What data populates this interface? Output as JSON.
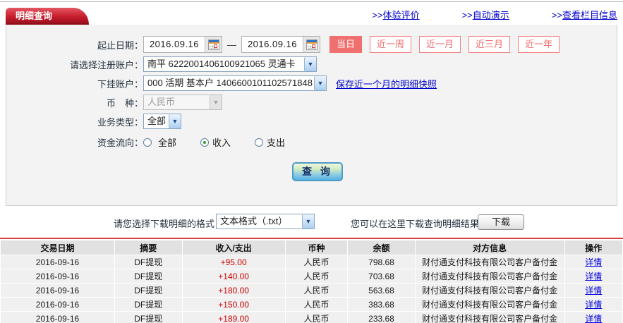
{
  "header": {
    "tab_title": "明细查询",
    "links": [
      {
        "prefix": ">>",
        "label": "体验评价"
      },
      {
        "prefix": ">>",
        "label": "自动演示"
      },
      {
        "prefix": ">>",
        "label": "查看栏目信息"
      }
    ]
  },
  "form": {
    "date_label": "起止日期：",
    "date_from": "2016.09.16",
    "date_separator": "—",
    "date_to": "2016.09.16",
    "quick_buttons": [
      {
        "label": "当日",
        "active": true
      },
      {
        "label": "近一周",
        "active": false
      },
      {
        "label": "近一月",
        "active": false
      },
      {
        "label": "近三月",
        "active": false
      },
      {
        "label": "近一年",
        "active": false
      }
    ],
    "register_account_label": "请选择注册账户：",
    "register_account_value": "南平 6222001406100921065 灵通卡",
    "sub_account_label": "下挂账户：",
    "sub_account_value": "000 活期 基本户 1406600101102571848",
    "snapshot_link": "保存近一个月的明细快照",
    "currency_label": "币　种：",
    "currency_value": "人民币",
    "business_type_label": "业务类型：",
    "business_type_value": "全部",
    "flow_label": "资金流向：",
    "flow_options": [
      {
        "label": "全部",
        "checked": false
      },
      {
        "label": "收入",
        "checked": true
      },
      {
        "label": "支出",
        "checked": false
      }
    ],
    "query_button": "查 询"
  },
  "download": {
    "format_label": "请您选择下载明细的格式",
    "format_value": "文本格式（.txt）",
    "hint": "您可以在这里下载查询明细结果",
    "button": "下载"
  },
  "table": {
    "headers": [
      "交易日期",
      "摘要",
      "收入/支出",
      "币种",
      "余额",
      "对方信息",
      "操作"
    ],
    "rows": [
      {
        "date": "2016-09-16",
        "summary": "DF提现",
        "amount": "+95.00",
        "currency": "人民币",
        "balance": "798.68",
        "counterparty": "财付通支付科技有限公司客户备付金",
        "action": "详情"
      },
      {
        "date": "2016-09-16",
        "summary": "DF提现",
        "amount": "+140.00",
        "currency": "人民币",
        "balance": "703.68",
        "counterparty": "财付通支付科技有限公司客户备付金",
        "action": "详情"
      },
      {
        "date": "2016-09-16",
        "summary": "DF提现",
        "amount": "+180.00",
        "currency": "人民币",
        "balance": "563.68",
        "counterparty": "财付通支付科技有限公司客户备付金",
        "action": "详情"
      },
      {
        "date": "2016-09-16",
        "summary": "DF提现",
        "amount": "+150.00",
        "currency": "人民币",
        "balance": "383.68",
        "counterparty": "财付通支付科技有限公司客户备付金",
        "action": "详情"
      },
      {
        "date": "2016-09-16",
        "summary": "DF提现",
        "amount": "+189.00",
        "currency": "人民币",
        "balance": "233.68",
        "counterparty": "财付通支付科技有限公司客户备付金",
        "action": "详情"
      }
    ]
  },
  "colors": {
    "tab_red": "#c91f2e",
    "quick_button_red": "#f07070",
    "link_blue": "#0000cc",
    "amount_red": "#cc0000",
    "divider_red": "#d43f49",
    "query_button_blue": "#55b2df"
  }
}
